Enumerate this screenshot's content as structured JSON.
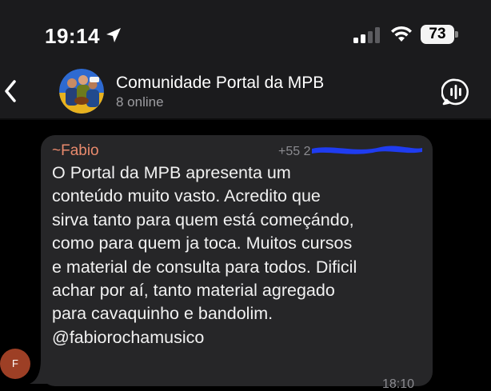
{
  "status_bar": {
    "time": "19:14",
    "battery": "73",
    "icons": [
      "location-arrow-icon",
      "cellular-signal-icon",
      "wifi-icon",
      "battery-icon"
    ]
  },
  "header": {
    "title": "Comunidade Portal da MPB",
    "subtitle": "8 online",
    "icons": [
      "chevron-left-icon",
      "group-avatar-icon",
      "voice-chat-icon"
    ]
  },
  "message": {
    "sender": "~Fabio",
    "phone": "+55 2",
    "text": "O Portal da MPB apresenta um\nconteúdo muito vasto. Acredito que\nsirva tanto para quem está começándo,\ncomo para quem ja toca. Muitos cursos\ne material de consulta para todos. Dificil\nachar por aí, tanto material agregado\npara cavaquinho e bandolim.\n@fabiorochamusico",
    "time": "18:10",
    "avatar_initial": "F"
  },
  "colors": {
    "background": "#000000",
    "header": "#1b1b1d",
    "bubble": "#262628",
    "sender": "#e98a6d",
    "meta": "#8b8b90",
    "redaction": "#1f3cf0",
    "avatar": "#9d3f25"
  }
}
